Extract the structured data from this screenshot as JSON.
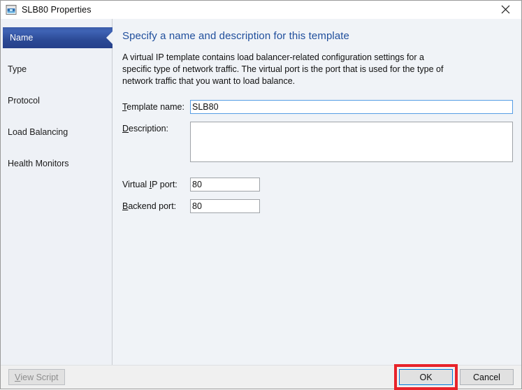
{
  "window": {
    "title": "SLB80 Properties",
    "icon": "template-window-icon",
    "close_label": "Close"
  },
  "sidebar": {
    "items": [
      {
        "label": "Name",
        "selected": true
      },
      {
        "label": "Type",
        "selected": false
      },
      {
        "label": "Protocol",
        "selected": false
      },
      {
        "label": "Load Balancing",
        "selected": false
      },
      {
        "label": "Health Monitors",
        "selected": false
      }
    ]
  },
  "content": {
    "heading": "Specify a name and description for this template",
    "description": "A virtual IP template contains load balancer-related configuration settings for a specific type of network traffic. The virtual port is the port that is used for the type of network traffic that you want to load balance.",
    "fields": {
      "template_name": {
        "label_prefix": "",
        "label_accel": "T",
        "label_suffix": "emplate name:",
        "value": "SLB80",
        "placeholder": ""
      },
      "description": {
        "label_prefix": "",
        "label_accel": "D",
        "label_suffix": "escription:",
        "value": "",
        "placeholder": ""
      },
      "virtual_ip_port": {
        "label_prefix": "Virtual ",
        "label_accel": "I",
        "label_suffix": "P port:",
        "value": "80",
        "placeholder": ""
      },
      "backend_port": {
        "label_prefix": "",
        "label_accel": "B",
        "label_suffix": "ackend port:",
        "value": "80",
        "placeholder": ""
      }
    }
  },
  "footer": {
    "view_script": {
      "accel": "V",
      "rest": "iew Script",
      "disabled": true
    },
    "ok_label": "OK",
    "cancel_label": "Cancel"
  },
  "colors": {
    "accent_blue": "#1f4e9c",
    "selected_nav": "#2c4a96",
    "focus_border": "#0078d7",
    "annotation_red": "#e8232a"
  }
}
